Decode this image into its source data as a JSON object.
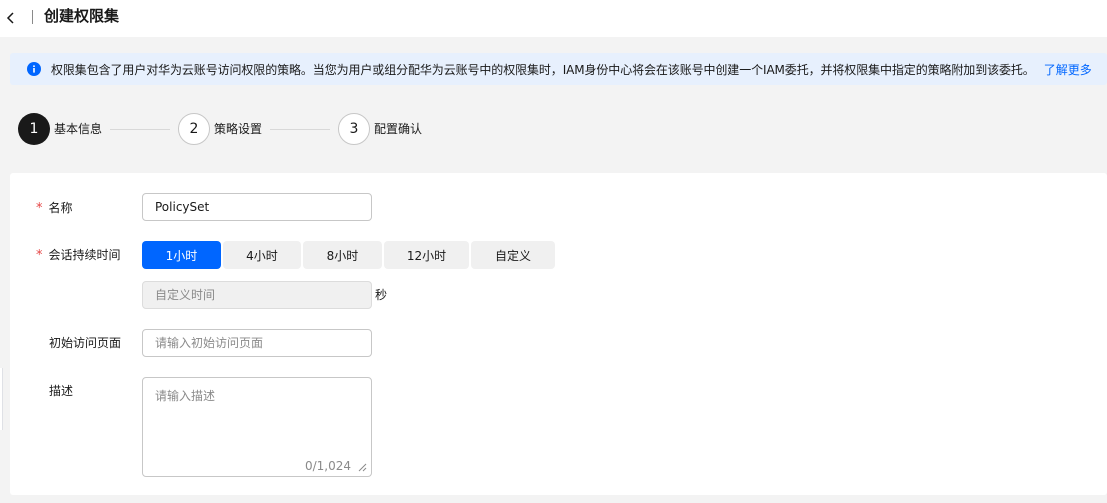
{
  "header": {
    "back_icon": "chevron-left-icon",
    "title": "创建权限集"
  },
  "banner": {
    "icon": "info-icon",
    "text": "权限集包含了用户对华为云账号访问权限的策略。当您为用户或组分配华为云账号中的权限集时，IAM身份中心将会在该账号中创建一个IAM委托，并将权限集中指定的策略附加到该委托。",
    "link": "了解更多"
  },
  "steps": [
    {
      "number": "1",
      "label": "基本信息",
      "state": "active"
    },
    {
      "number": "2",
      "label": "策略设置",
      "state": "todo"
    },
    {
      "number": "3",
      "label": "配置确认",
      "state": "todo"
    }
  ],
  "form": {
    "name": {
      "required_mark": "*",
      "label": "名称",
      "value": "PolicySet"
    },
    "session": {
      "required_mark": "*",
      "label": "会话持续时间",
      "options": [
        "1小时",
        "4小时",
        "8小时",
        "12小时",
        "自定义"
      ],
      "selected": "1小时",
      "custom_placeholder": "自定义时间",
      "custom_unit": "秒"
    },
    "start_page": {
      "label": "初始访问页面",
      "placeholder": "请输入初始访问页面"
    },
    "description": {
      "label": "描述",
      "placeholder": "请输入描述",
      "counter": "0/1,024"
    }
  },
  "colors": {
    "primary": "#0066ff",
    "required": "#e54545",
    "banner_bg": "#e7f0fd",
    "active_step": "#191919"
  }
}
